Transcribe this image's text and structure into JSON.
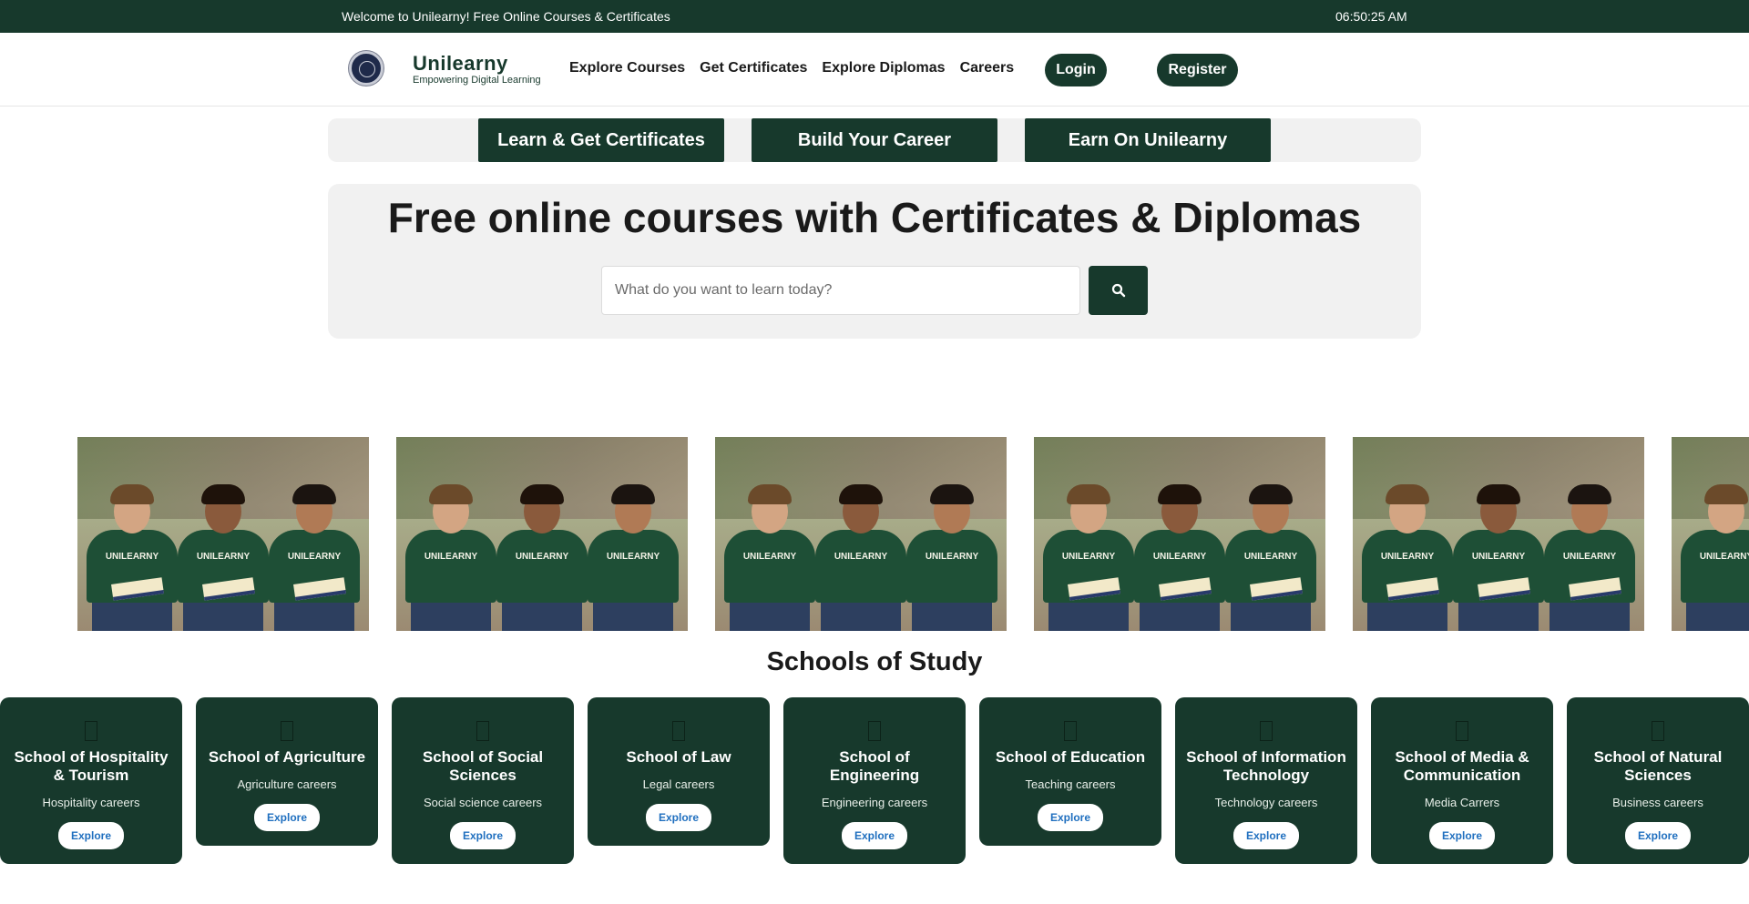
{
  "topbar": {
    "welcome": "Welcome to Unilearny! Free Online Courses & Certificates",
    "clock": "06:50:25 AM"
  },
  "brand": {
    "name": "Unilearny",
    "tagline": "Empowering Digital Learning"
  },
  "nav": {
    "links": [
      "Explore Courses",
      "Get Certificates",
      "Explore Diplomas",
      "Careers"
    ],
    "login": "Login",
    "register": "Register"
  },
  "tabs": [
    "Learn & Get Certificates",
    "Build Your Career",
    "Earn On Unilearny"
  ],
  "hero": {
    "title": "Free online courses with Certificates & Diplomas",
    "search_placeholder": "What do you want to learn today?"
  },
  "photos": {
    "shirt_text": "UNILEARNY",
    "items": [
      {
        "variant": "seated-books"
      },
      {
        "variant": "pointing"
      },
      {
        "variant": "standing-backpacks"
      },
      {
        "variant": "seated-books"
      },
      {
        "variant": "seated-books"
      },
      {
        "variant": "standing-backpacks"
      }
    ]
  },
  "schools": {
    "title": "Schools of Study",
    "explore_label": "Explore",
    "items": [
      {
        "title": "School of Hospitality & Tourism",
        "subtitle": "Hospitality careers"
      },
      {
        "title": "School of Agriculture",
        "subtitle": "Agriculture careers"
      },
      {
        "title": "School of Social Sciences",
        "subtitle": "Social science careers"
      },
      {
        "title": "School of Law",
        "subtitle": "Legal careers"
      },
      {
        "title": "School of Engineering",
        "subtitle": "Engineering careers"
      },
      {
        "title": "School of Education",
        "subtitle": "Teaching careers"
      },
      {
        "title": "School of Information Technology",
        "subtitle": "Technology careers"
      },
      {
        "title": "School of Media & Communication",
        "subtitle": "Media Carrers"
      },
      {
        "title": "School of Natural Sciences",
        "subtitle": "Business careers"
      }
    ]
  },
  "colors": {
    "brand_green": "#17392c",
    "link_blue": "#1f6fbf"
  }
}
